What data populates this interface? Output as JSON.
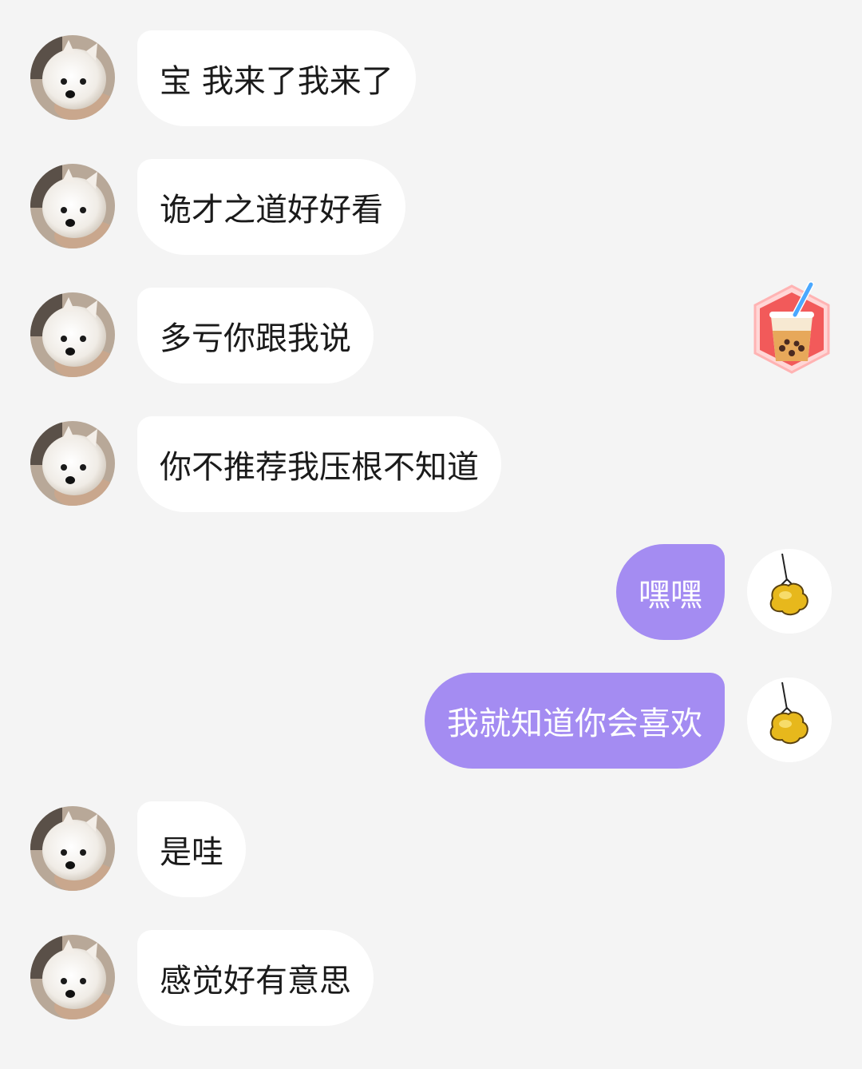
{
  "messages": [
    {
      "side": "left",
      "text": "宝 我来了我来了"
    },
    {
      "side": "left",
      "text": "诡才之道好好看"
    },
    {
      "side": "left",
      "text": "多亏你跟我说"
    },
    {
      "side": "left",
      "text": "你不推荐我压根不知道"
    },
    {
      "side": "right",
      "text": "嘿嘿"
    },
    {
      "side": "right",
      "text": "我就知道你会喜欢"
    },
    {
      "side": "left",
      "text": "是哇"
    },
    {
      "side": "left",
      "text": "感觉好有意思"
    }
  ],
  "sticker": {
    "icon": "bubble-tea-icon"
  },
  "colors": {
    "background": "#f4f4f4",
    "incoming_bubble": "#ffffff",
    "outgoing_bubble": "#a48cf2",
    "outgoing_text": "#ffffff"
  },
  "avatars": {
    "incoming": "dog-avatar",
    "outgoing": "gold-charm-avatar"
  }
}
